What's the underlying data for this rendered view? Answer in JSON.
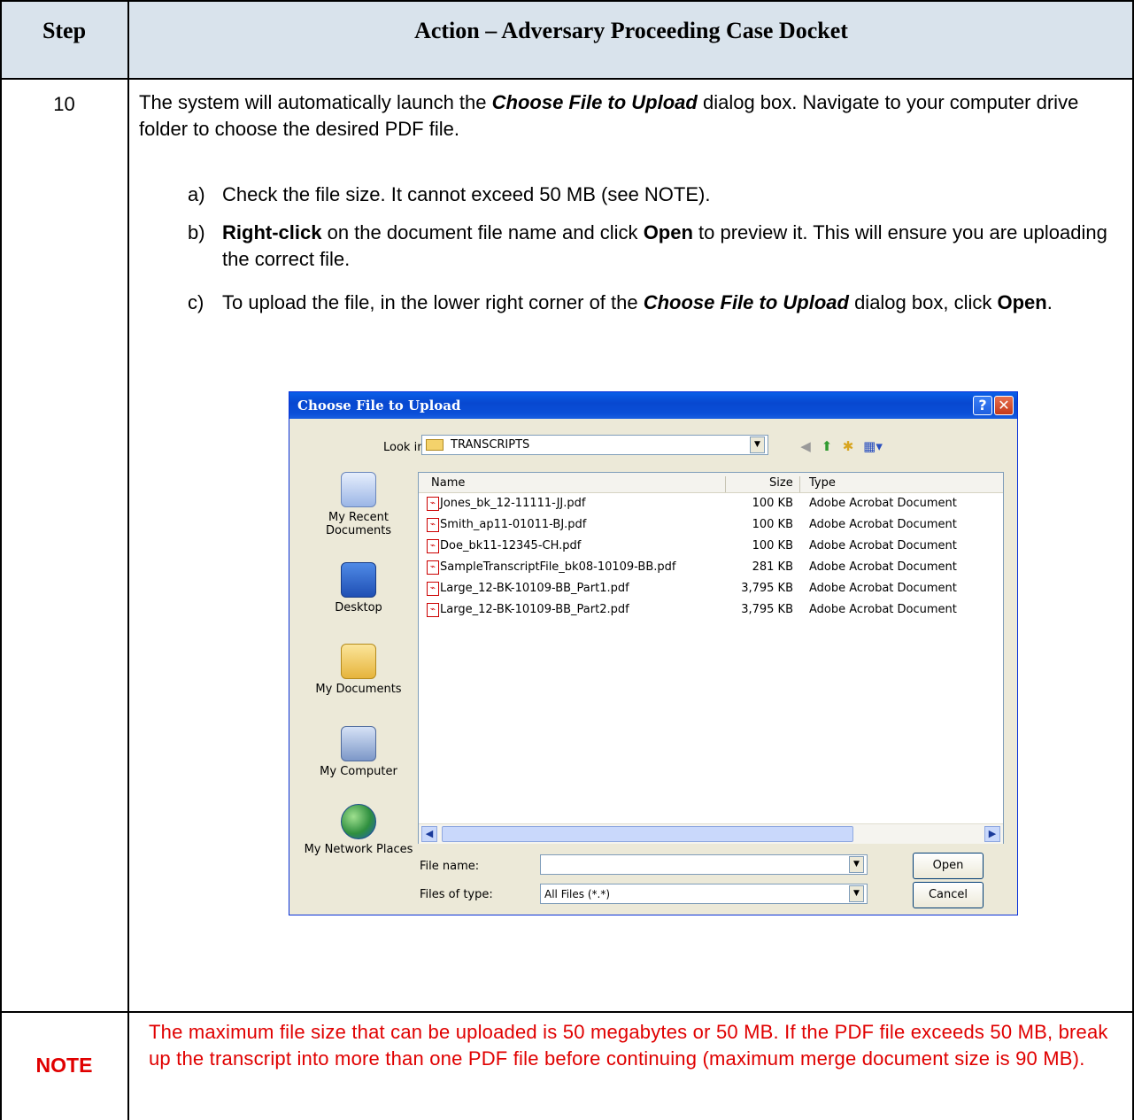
{
  "table": {
    "header": {
      "step": "Step",
      "action": "Action – Adversary Proceeding Case Docket"
    },
    "step_number": "10",
    "intro": {
      "part1": "The system will automatically launch the ",
      "dialog_name": "Choose File to Upload",
      "part2": " dialog box. Navigate to your computer drive folder to choose the desired PDF file."
    },
    "items": [
      {
        "label": "a)",
        "text": "Check the file size. It cannot exceed 50 MB (see NOTE)."
      },
      {
        "label": "b)",
        "strong1": "Right-click",
        "text1": " on the document file name and click ",
        "strong2": "Open",
        "text2": " to preview it.  This will ensure you are uploading the correct file."
      },
      {
        "label": "c)",
        "text1": "To upload the file, in the lower right corner of the ",
        "dialog_name": "Choose File to Upload",
        "text2": " dialog box, click ",
        "strong": "Open",
        "text3": "."
      }
    ],
    "note": {
      "label": "NOTE",
      "text": "The maximum file size that can be uploaded is 50 megabytes or 50 MB.  If the PDF file exceeds 50 MB, break up the transcript into more than one PDF file before continuing (maximum merge document size is 90 MB)."
    }
  },
  "dialog": {
    "title": "Choose File to Upload",
    "help_glyph": "?",
    "close_glyph": "✕",
    "look_in_label": "Look in:",
    "look_in_value": "TRANSCRIPTS",
    "places": [
      "My Recent Documents",
      "Desktop",
      "My Documents",
      "My Computer",
      "My Network Places"
    ],
    "columns": {
      "name": "Name",
      "size": "Size",
      "type": "Type"
    },
    "files": [
      {
        "name": "Jones_bk_12-11111-JJ.pdf",
        "size": "100 KB",
        "type": "Adobe Acrobat Document"
      },
      {
        "name": "Smith_ap11-01011-BJ.pdf",
        "size": "100 KB",
        "type": "Adobe Acrobat Document"
      },
      {
        "name": "Doe_bk11-12345-CH.pdf",
        "size": "100 KB",
        "type": "Adobe Acrobat Document"
      },
      {
        "name": "SampleTranscriptFile_bk08-10109-BB.pdf",
        "size": "281 KB",
        "type": "Adobe Acrobat Document"
      },
      {
        "name": "Large_12-BK-10109-BB_Part1.pdf",
        "size": "3,795 KB",
        "type": "Adobe Acrobat Document"
      },
      {
        "name": "Large_12-BK-10109-BB_Part2.pdf",
        "size": "3,795 KB",
        "type": "Adobe Acrobat Document"
      }
    ],
    "file_name_label": "File name:",
    "file_name_value": "",
    "files_of_type_label": "Files of type:",
    "files_of_type_value": "All Files (*.*)",
    "open_label": "Open",
    "cancel_label": "Cancel"
  }
}
